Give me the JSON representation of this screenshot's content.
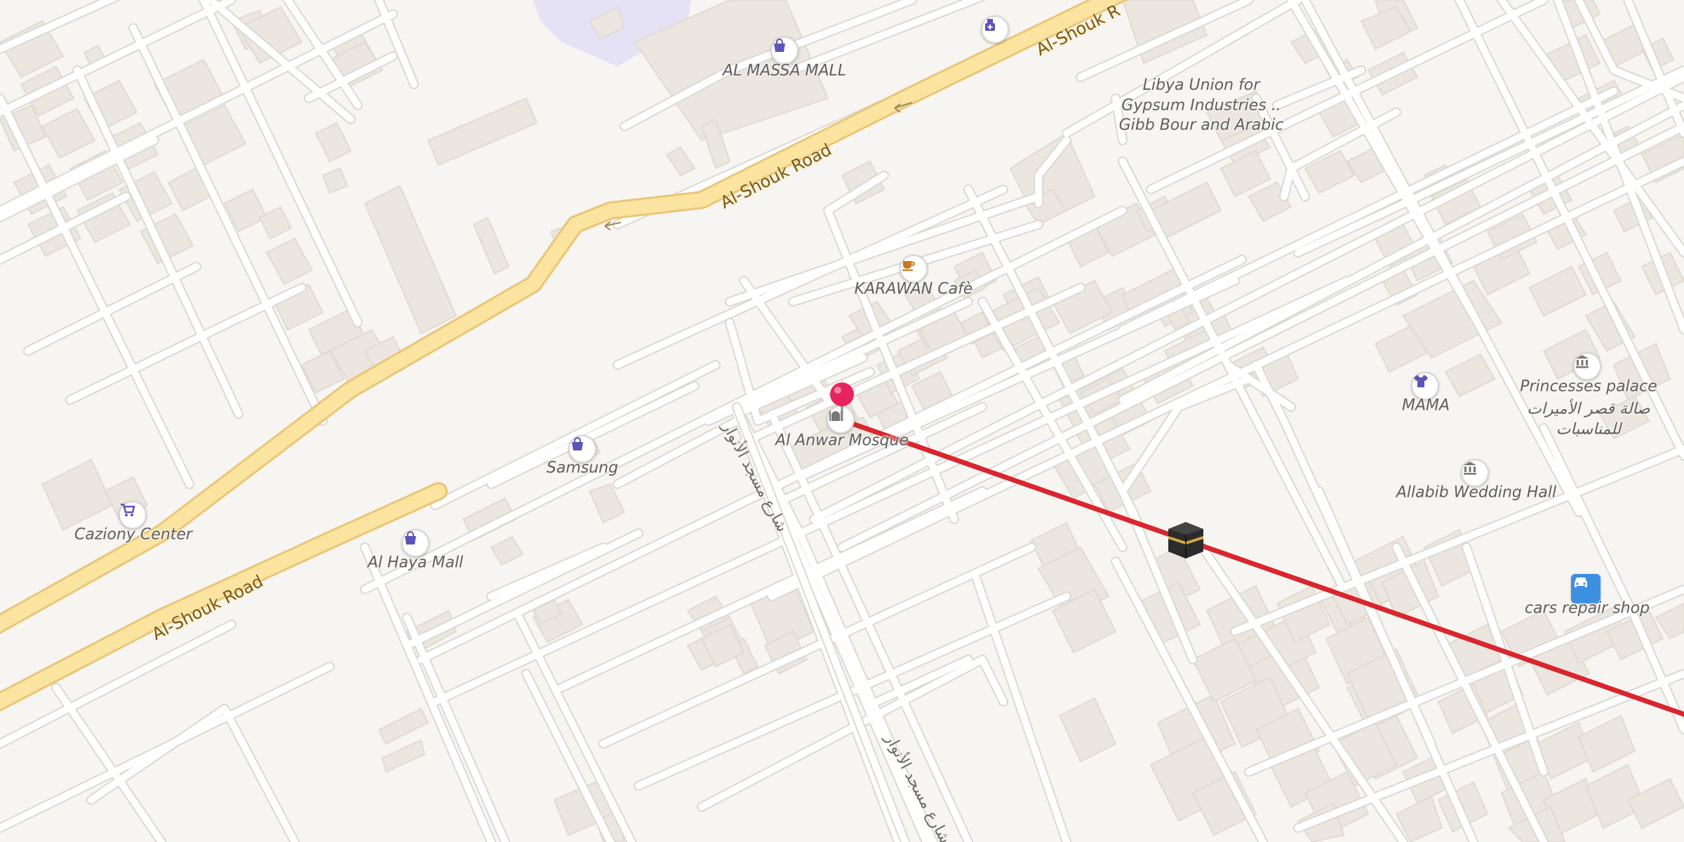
{
  "map": {
    "roads": {
      "upper": "Al-Shouk Road",
      "upper_right": "Al-Shouk R",
      "lower": "Al-Shouk Road"
    },
    "streets": {
      "arabic_1": "شارع مسجد الأنوار",
      "arabic_2": "شارع مسجد الأنوار"
    },
    "pois": {
      "al_massa_mall": "AL MASSA MALL",
      "libya_union": "Libya Union for Gypsum Industries .. Gibb Bour and Arabic",
      "karawan": "KARAWAN Cafè",
      "al_anwar_mosque": "Al Anwar Mosque",
      "samsung": "Samsung",
      "cazioni": "Caziony Center",
      "al_haya_mall": "Al Haya Mall",
      "mama": "MAMA",
      "princesses_palace": "Princesses palace",
      "princesses_palace_ar": "صالة قصر الأميرات للمناسبات",
      "allabib": "Allabib Wedding Hall",
      "cars_repair": "cars repair shop"
    },
    "colors": {
      "background": "#f7f5f2",
      "street": "#ffffff",
      "street_edge": "#dcd8d2",
      "main_road": "#fbe3a0",
      "main_road_edge": "#e9c677",
      "building": "#ebe6df",
      "qibla_line": "#d9262e",
      "pin": "#e8245f",
      "poi_icon": "#5b55b8",
      "cafe_icon": "#c87a1a",
      "landmark_icon": "#777777"
    },
    "icons": {
      "pin": "location-pin-icon",
      "kaaba": "kaaba-icon",
      "shopping": "shopping-bag-icon",
      "cart": "cart-icon",
      "cafe": "coffee-cup-icon",
      "mosque": "mosque-icon",
      "museum": "landmark-icon",
      "clothes": "shirt-icon",
      "car": "car-icon",
      "pharmacy": "pharmacy-icon"
    }
  }
}
